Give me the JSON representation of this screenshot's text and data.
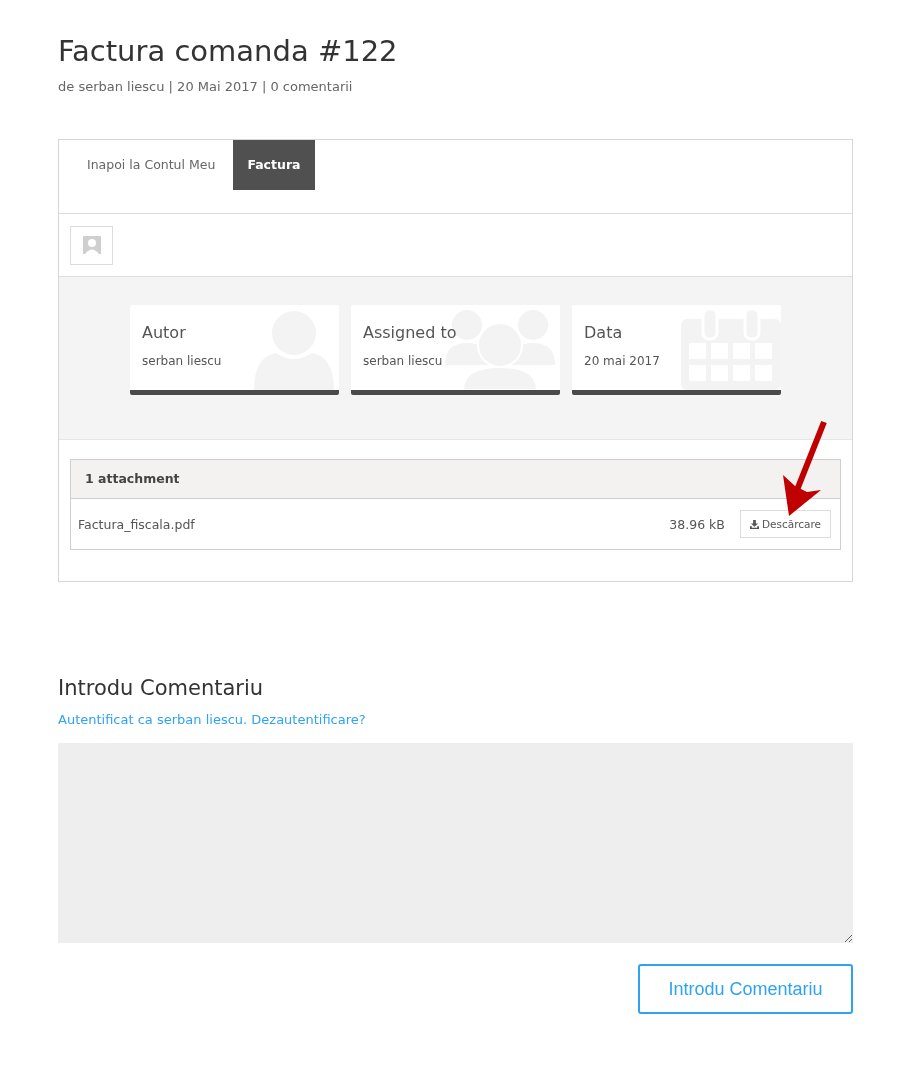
{
  "post": {
    "title": "Factura comanda #122",
    "meta": "de serban liescu | 20 Mai 2017 | 0 comentarii"
  },
  "tabs": [
    {
      "label": "Inapoi la Contul Meu",
      "selected": false
    },
    {
      "label": "Factura",
      "selected": true
    }
  ],
  "cards": [
    {
      "kind": "person",
      "label": "Autor",
      "value": "serban liescu"
    },
    {
      "kind": "group",
      "label": "Assigned to",
      "value": "serban liescu"
    },
    {
      "kind": "calendar",
      "label": "Data",
      "value": "20 mai 2017"
    }
  ],
  "attachments": {
    "header": "1 attachment",
    "files": [
      {
        "name": "Factura_fiscala.pdf",
        "size": "38.96 kB",
        "button": "Descărcare"
      }
    ]
  },
  "annotation": {
    "kind": "arrow",
    "color": "#c00000"
  },
  "comment": {
    "heading": "Introdu Comentariu",
    "logged_in": "Autentificat ca serban liescu",
    "separator": ". ",
    "logout": "Dezautentificare?",
    "submit": "Introdu Comentariu"
  }
}
